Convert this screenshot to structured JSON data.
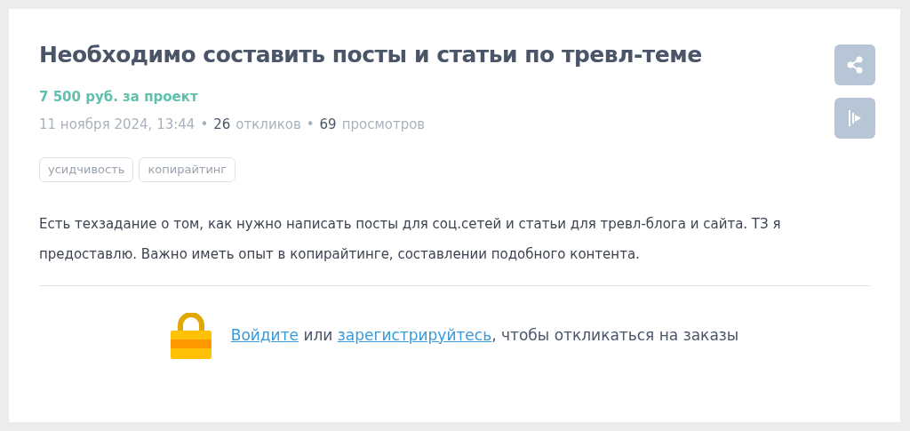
{
  "title": "Необходимо составить посты и статьи по тревл-теме",
  "price": "7 500 руб. за проект",
  "meta": [
    {
      "kind": "muted",
      "text": "11 ноября 2024, 13:44"
    },
    {
      "kind": "separator",
      "text": "•"
    },
    {
      "kind": "count",
      "text": "26"
    },
    {
      "kind": "muted",
      "text": "откликов"
    },
    {
      "kind": "separator",
      "text": "•"
    },
    {
      "kind": "count",
      "text": "69"
    },
    {
      "kind": "muted",
      "text": "просмотров"
    }
  ],
  "tags": [
    "усидчивость",
    "копирайтинг"
  ],
  "description": "Есть техзадание о том, как нужно написать посты для соц.сетей и статьи для тревл-блога и сайта. ТЗ я предоставлю. Важно иметь опыт в копирайтинге, составлении подобного контента.",
  "login_prompt": {
    "login_link": "Войдите",
    "middle": "или",
    "register_link": "зарегистрируйтесь",
    "rest": ", чтобы откликаться на заказы"
  }
}
